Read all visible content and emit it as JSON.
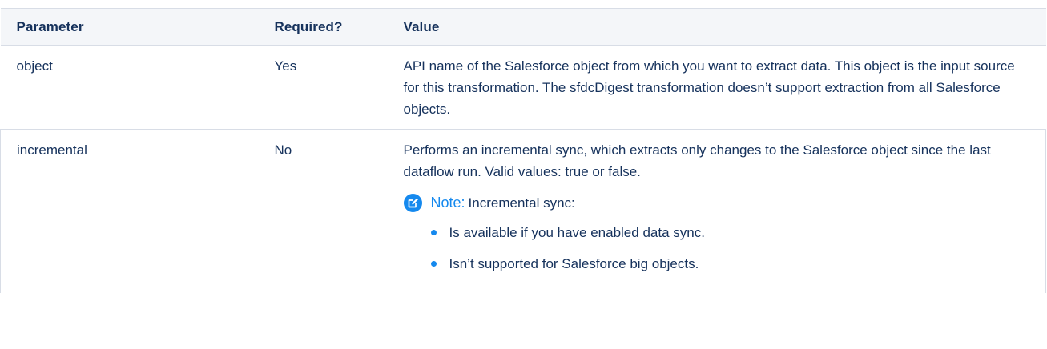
{
  "table": {
    "headers": [
      "Parameter",
      "Required?",
      "Value"
    ],
    "rows": [
      {
        "parameter": "object",
        "required": "Yes",
        "value": "API name of the Salesforce object from which you want to extract data. This object is the input source for this transformation. The sfdcDigest transformation doesn’t support extraction from all Salesforce objects."
      },
      {
        "parameter": "incremental",
        "required": "No",
        "value": "Performs an incremental sync, which extracts only changes to the Salesforce object since the last dataflow run. Valid values: true or false.",
        "note": {
          "icon": "edit-note-icon",
          "label": "Note:",
          "text": "Incremental sync:",
          "items": [
            "Is available if you have enabled data sync.",
            "Isn’t supported for Salesforce big objects."
          ]
        }
      }
    ]
  },
  "colors": {
    "text": "#16325c",
    "header_bg": "#f4f6f9",
    "border": "#d8dde6",
    "accent": "#1589ee"
  }
}
